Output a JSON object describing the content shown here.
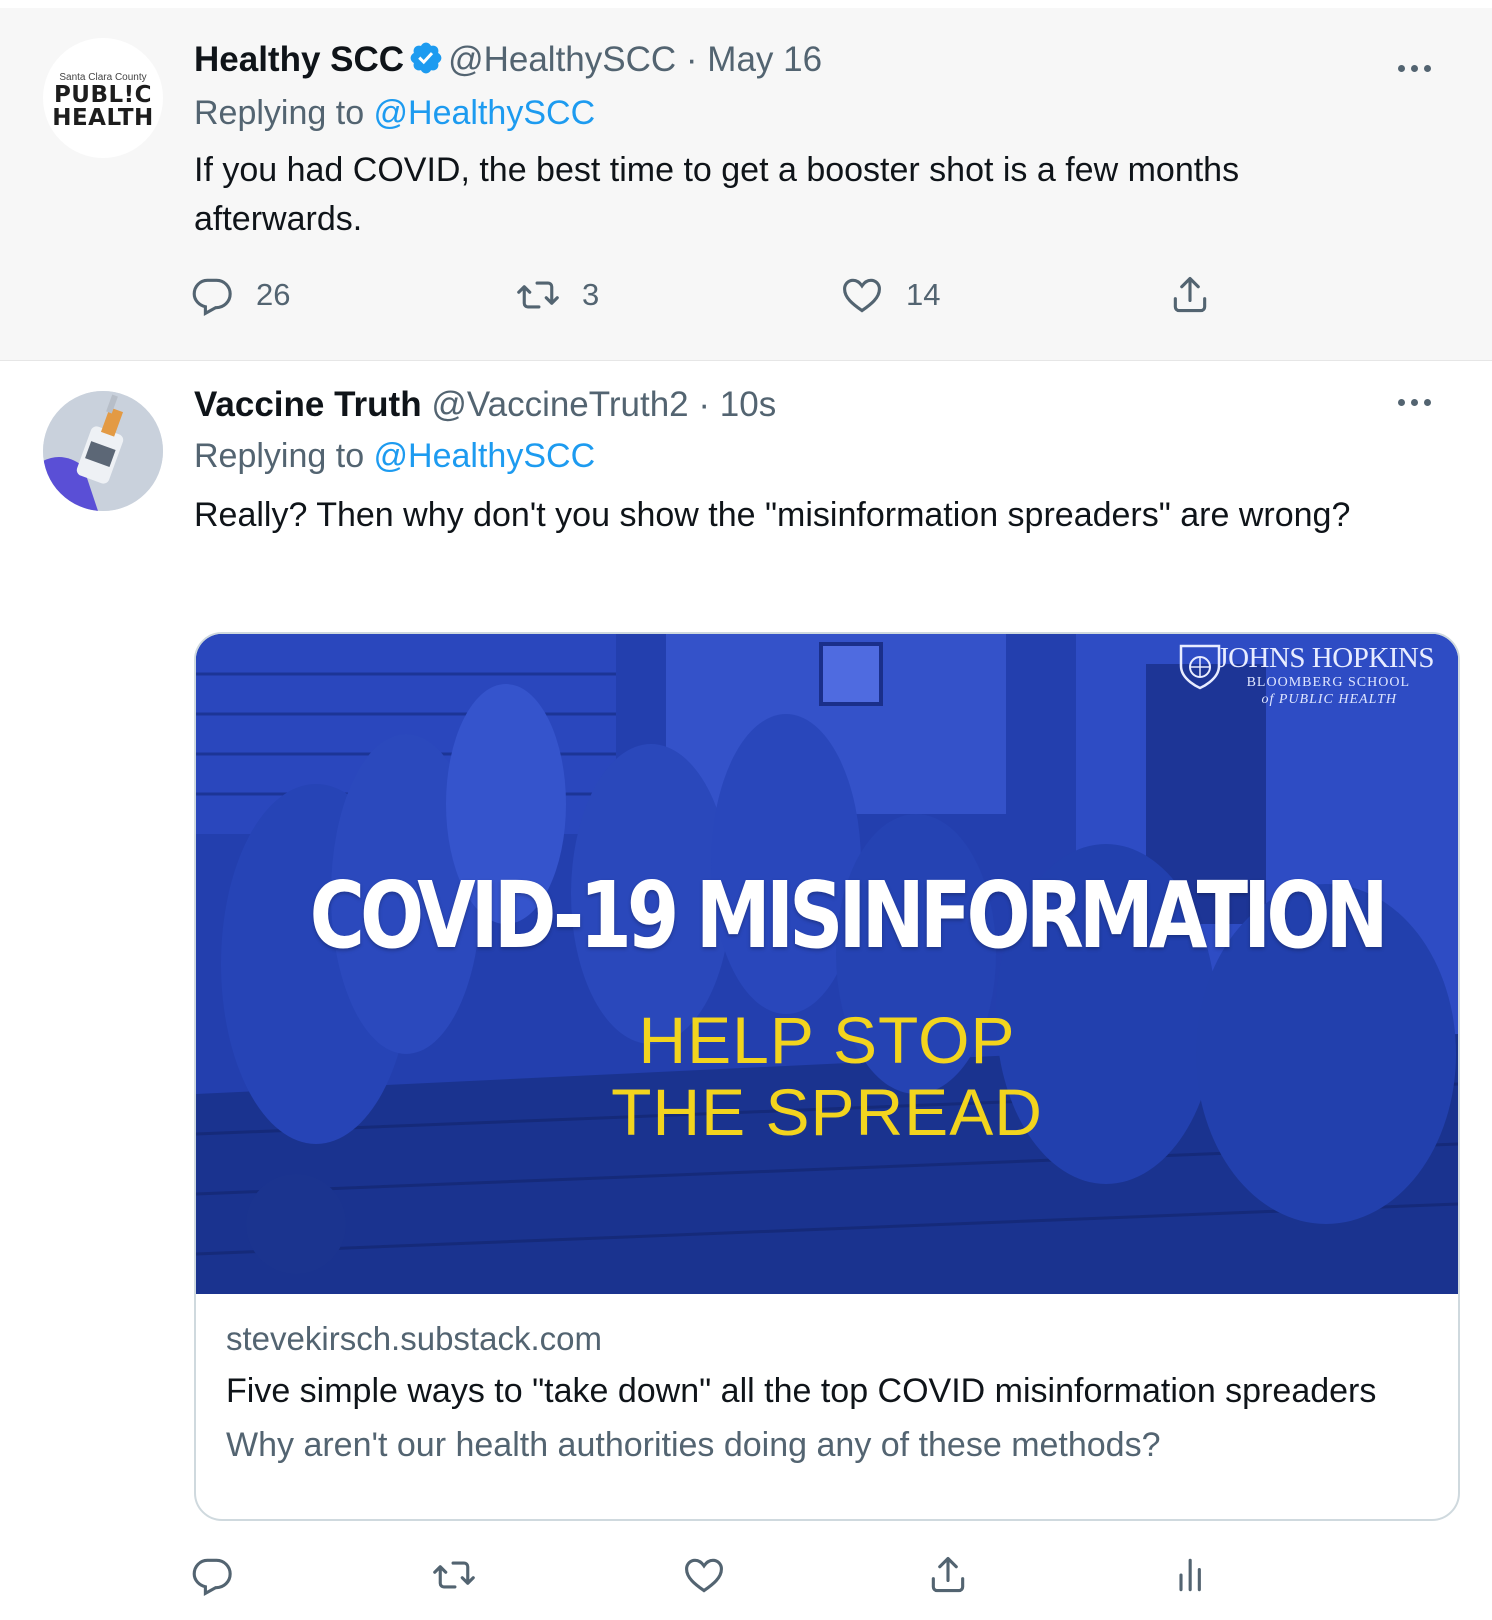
{
  "tweets": [
    {
      "avatar": {
        "small": "Santa Clara County",
        "line1": "PUBL!C",
        "line2": "HEALTH"
      },
      "name": "Healthy SCC",
      "handle": "@HealthySCC",
      "separator": "·",
      "time": "May 16",
      "replying_label": "Replying to ",
      "replying_handle": "@HealthySCC",
      "text": "If you had COVID, the best time to get a booster shot is a few months afterwards.",
      "reply_count": "26",
      "retweet_count": "3",
      "like_count": "14"
    },
    {
      "name": "Vaccine Truth",
      "handle": "@VaccineTruth2",
      "separator": "·",
      "time": "10s",
      "replying_label": "Replying to ",
      "replying_handle": "@HealthySCC",
      "text": "Really? Then why don't you show the \"misinformation spreaders\" are wrong?",
      "card": {
        "logo_title": "JOHNS HOPKINS",
        "logo_sub1": "BLOOMBERG SCHOOL",
        "logo_sub2": "of PUBLIC HEALTH",
        "headline": "COVID-19 MISINFORMATION",
        "subline1": "HELP STOP",
        "subline2": "THE SPREAD",
        "domain": "stevekirsch.substack.com",
        "title": "Five simple ways to \"take down\" all the top COVID misinformation spreaders",
        "description": "Why aren't our health authorities doing any of these methods?"
      }
    }
  ],
  "colors": {
    "accent": "#1d9bf0",
    "secondary_text": "#536471",
    "card_blue": "#1f3fb8",
    "card_yellow": "#f2d41e"
  },
  "icons": [
    "verified-badge-icon",
    "more-icon",
    "reply-icon",
    "retweet-icon",
    "like-icon",
    "share-icon",
    "analytics-icon"
  ]
}
